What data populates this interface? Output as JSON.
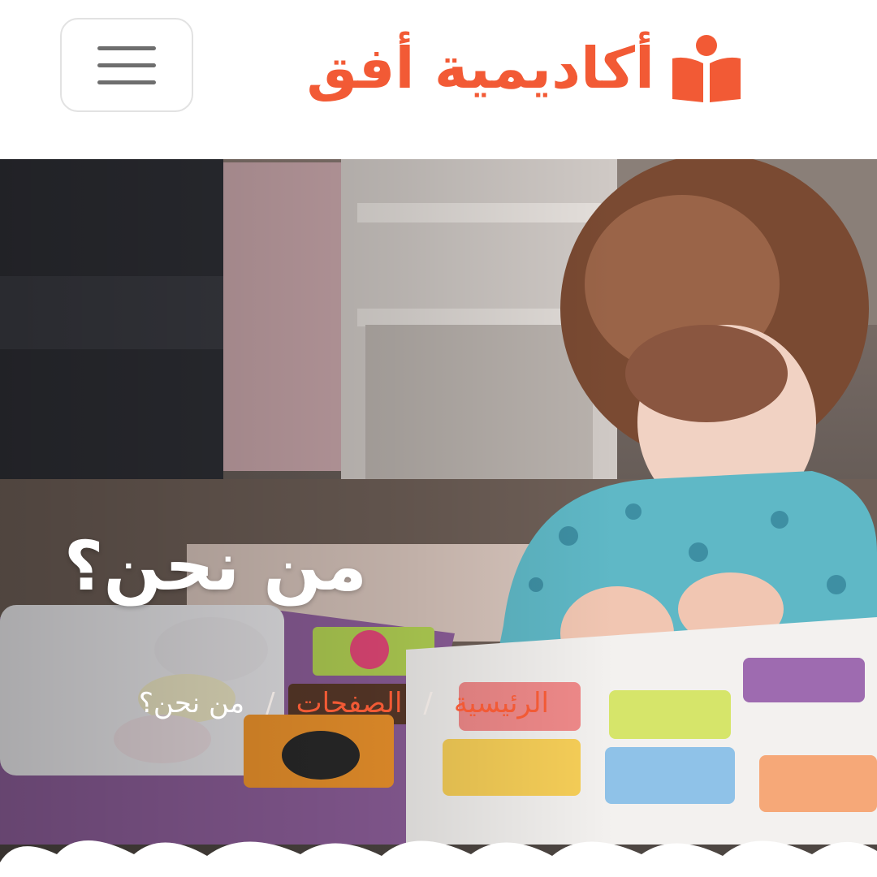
{
  "header": {
    "brand_name": "أكاديمية أفق",
    "brand_icon": "reading-child-icon",
    "menu_icon": "hamburger-menu-icon"
  },
  "hero": {
    "title": "من نحن؟",
    "breadcrumb": {
      "home": "الرئيسية",
      "pages": "الصفحات",
      "current": "من نحن؟",
      "separator": "/"
    }
  },
  "colors": {
    "accent": "#f25a35",
    "heading": "#ffffff",
    "menu_icon": "#6e6e6e",
    "menu_border": "#e2e2e2"
  }
}
